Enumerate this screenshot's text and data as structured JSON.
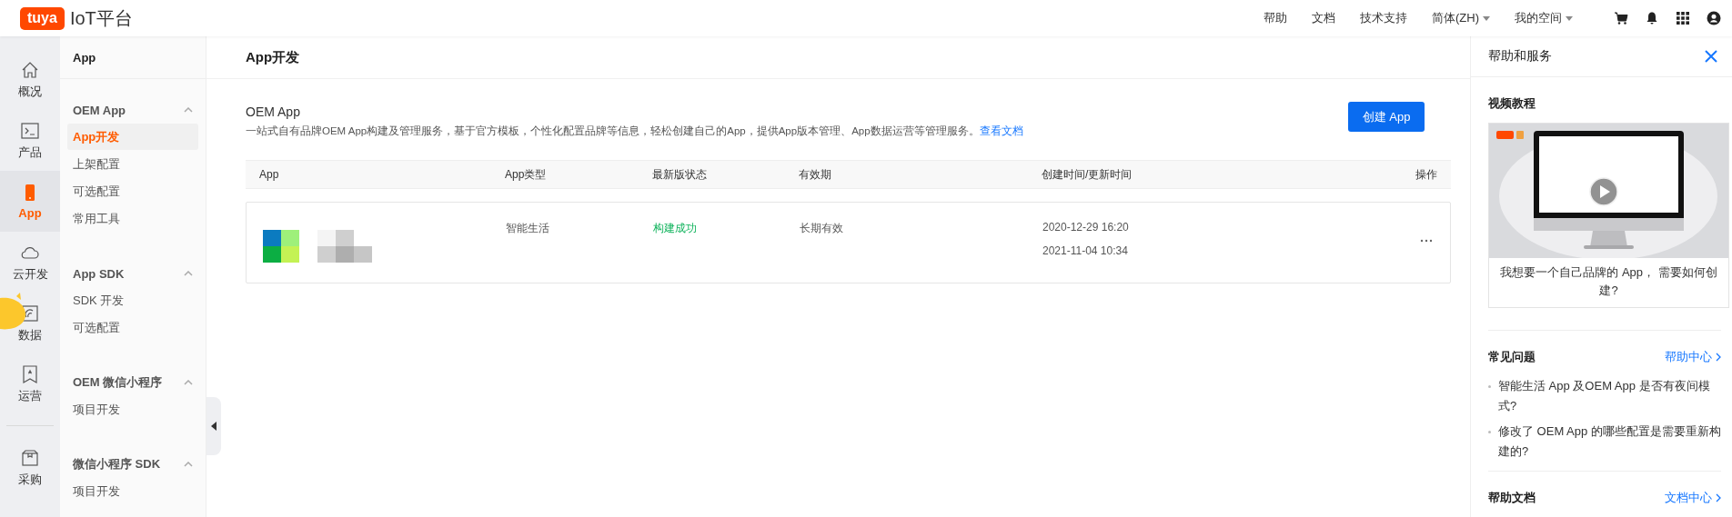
{
  "topbar": {
    "logo": "tuya",
    "title": "IoT平台",
    "links": [
      {
        "label": "帮助",
        "dropdown": false
      },
      {
        "label": "文档",
        "dropdown": false
      },
      {
        "label": "技术支持",
        "dropdown": false
      },
      {
        "label": "简体(ZH)",
        "dropdown": true
      },
      {
        "label": "我的空间",
        "dropdown": true
      }
    ]
  },
  "rail": {
    "items": [
      {
        "kind": "home",
        "label": "概况",
        "selected": false
      },
      {
        "kind": "terminal",
        "label": "产品",
        "selected": false
      },
      {
        "kind": "phone",
        "label": "App",
        "selected": true
      },
      {
        "kind": "cloud",
        "label": "云开发",
        "selected": false
      },
      {
        "kind": "data",
        "label": "数据",
        "selected": false
      },
      {
        "kind": "bookmark",
        "label": "运营",
        "selected": false
      },
      {
        "kind": "divider"
      },
      {
        "kind": "box",
        "label": "采购",
        "selected": false
      }
    ]
  },
  "sidebar": {
    "title": "App",
    "groups": [
      {
        "title": "OEM App",
        "expanded": true,
        "items": [
          {
            "label": "App开发",
            "selected": true
          },
          {
            "label": "上架配置",
            "selected": false
          },
          {
            "label": "可选配置",
            "selected": false
          },
          {
            "label": "常用工具",
            "selected": false
          }
        ]
      },
      {
        "title": "App SDK",
        "expanded": true,
        "items": [
          {
            "label": "SDK 开发",
            "selected": false
          },
          {
            "label": "可选配置",
            "selected": false
          }
        ]
      },
      {
        "title": "OEM 微信小程序",
        "expanded": true,
        "items": [
          {
            "label": "项目开发",
            "selected": false
          }
        ]
      },
      {
        "title": "微信小程序 SDK",
        "expanded": true,
        "items": [
          {
            "label": "项目开发",
            "selected": false
          }
        ]
      }
    ]
  },
  "main": {
    "title": "App开发",
    "section": {
      "title": "OEM App",
      "description": "一站式自有品牌OEM App构建及管理服务，基于官方模板，个性化配置品牌等信息，轻松创建自己的App，提供App版本管理、App数据运营等管理服务。",
      "link": "查看文档",
      "button": "创建 App"
    },
    "table": {
      "columns": [
        "App",
        "App类型",
        "最新版状态",
        "有效期",
        "创建时间/更新时间",
        "操作"
      ],
      "rows": [
        {
          "type": "智能生活",
          "status": "构建成功",
          "validity": "长期有效",
          "created": "2020-12-29 16:20",
          "updated": "2021-11-04 10:34"
        }
      ]
    }
  },
  "help_panel": {
    "title": "帮助和服务",
    "video": {
      "heading": "视频教程",
      "caption": "我想要一个自己品牌的 App， 需要如何创建?"
    },
    "faq": {
      "heading": "常见问题",
      "link": "帮助中心",
      "items": [
        "智能生活 App 及OEM App 是否有夜间模式?",
        "修改了 OEM App 的哪些配置是需要重新构建的?"
      ]
    },
    "docs": {
      "heading": "帮助文档",
      "link": "文档中心"
    }
  }
}
